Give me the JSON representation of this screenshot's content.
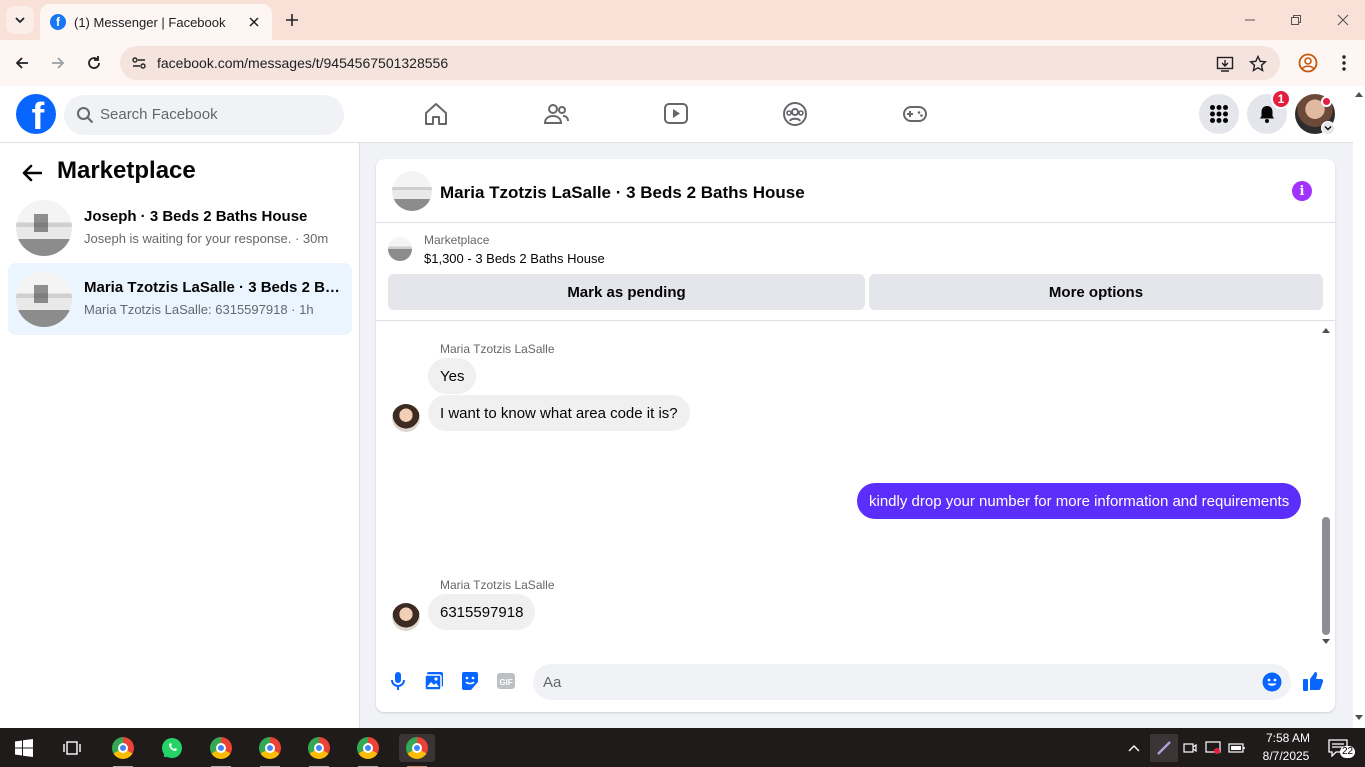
{
  "browser": {
    "tab_title": "(1) Messenger | Facebook",
    "url": "facebook.com/messages/t/9454567501328556"
  },
  "header": {
    "search_placeholder": "Search Facebook",
    "notification_count": "1",
    "accent": "#0866ff"
  },
  "sidebar": {
    "title": "Marketplace",
    "conversations": [
      {
        "name": "Joseph · 3 Beds 2 Baths House",
        "preview": "Joseph is waiting for your response. · 30m",
        "active": false
      },
      {
        "name": "Maria Tzotzis LaSalle · 3 Beds 2 Ba...",
        "preview": "Maria Tzotzis LaSalle: 6315597918 · 1h",
        "active": true
      }
    ]
  },
  "chat": {
    "title": "Maria Tzotzis LaSalle · 3 Beds 2 Baths House",
    "marketplace_label": "Marketplace",
    "listing": "$1,300 - 3 Beds 2 Baths House",
    "mark_pending_label": "Mark as pending",
    "more_options_label": "More options",
    "messages": [
      {
        "sender": "Maria Tzotzis LaSalle",
        "text": "Yes"
      },
      {
        "text": "I want to know what area code it is?"
      },
      {
        "text": "kindly drop your number for more information and requirements",
        "outgoing": true
      },
      {
        "sender": "Maria Tzotzis LaSalle",
        "text": "6315597918"
      }
    ],
    "composer_placeholder": "Aa",
    "outgoing_color": "#5b2efc"
  },
  "taskbar": {
    "time": "7:58 AM",
    "date": "8/7/2025",
    "notif_count": "22"
  }
}
